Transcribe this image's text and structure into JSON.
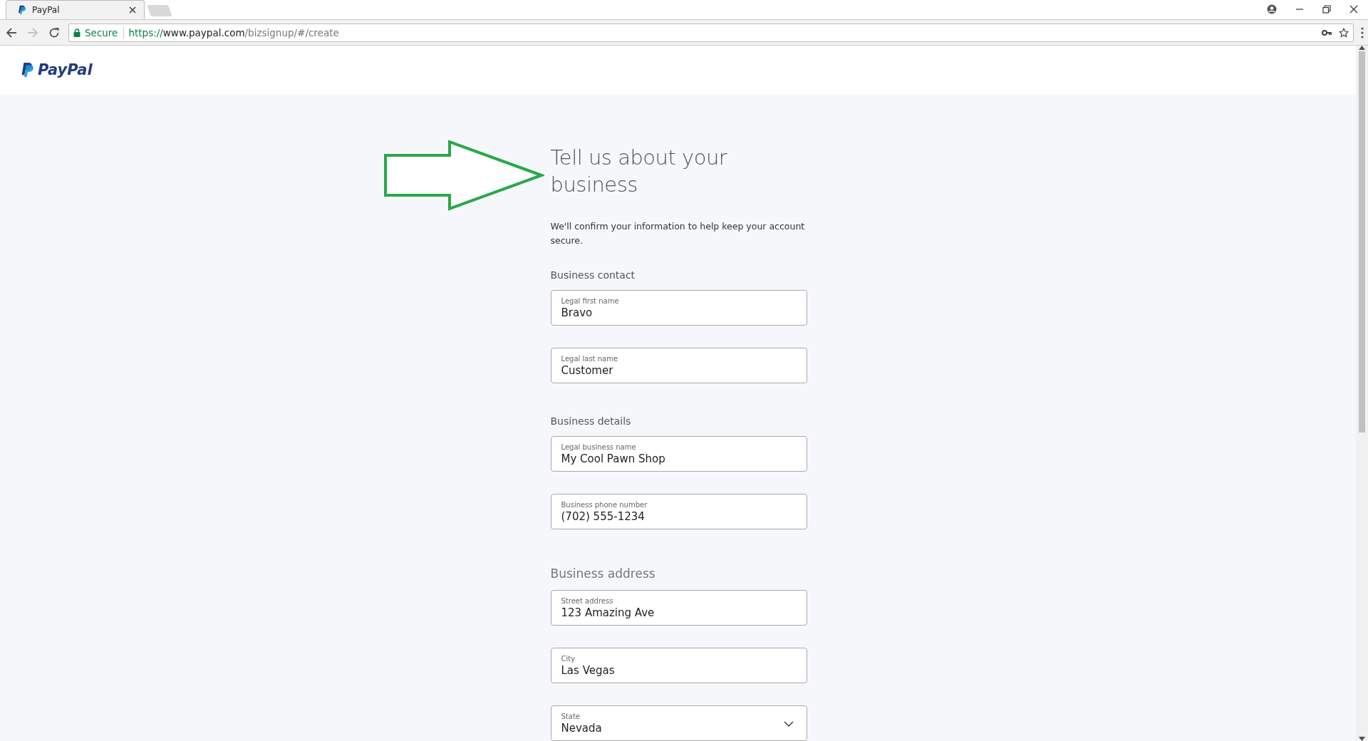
{
  "browser": {
    "tabs": [
      {
        "title": "PayPal",
        "selected": true
      }
    ],
    "nav": [
      {
        "kind": "back",
        "disabled": false
      },
      {
        "kind": "forward",
        "disabled": true
      },
      {
        "kind": "reload",
        "disabled": false
      }
    ],
    "security_label": "Secure",
    "url": {
      "scheme": "https://",
      "host": "www.paypal.com",
      "path": "/bizsignup/#/create"
    }
  },
  "header": {
    "logo": "PayPal"
  },
  "form": {
    "heading": "Tell us about your business",
    "subtitle": "We'll confirm your information to help keep your account secure.",
    "sections": [
      {
        "title": "Business contact",
        "fields": [
          {
            "kind": "text",
            "label": "Legal first name",
            "value": "Bravo"
          },
          {
            "kind": "text",
            "label": "Legal last name",
            "value": "Customer"
          }
        ]
      },
      {
        "title": "Business details",
        "fields": [
          {
            "kind": "text",
            "label": "Legal business name",
            "value": "My Cool Pawn Shop"
          },
          {
            "kind": "text",
            "label": "Business phone number",
            "value": "(702) 555-1234"
          }
        ]
      },
      {
        "title": "Business address",
        "fields": [
          {
            "kind": "text",
            "label": "Street address",
            "value": "123 Amazing Ave"
          },
          {
            "kind": "text",
            "label": "City",
            "value": "Las Vegas"
          },
          {
            "kind": "select",
            "label": "State",
            "value": "Nevada"
          }
        ]
      }
    ]
  }
}
